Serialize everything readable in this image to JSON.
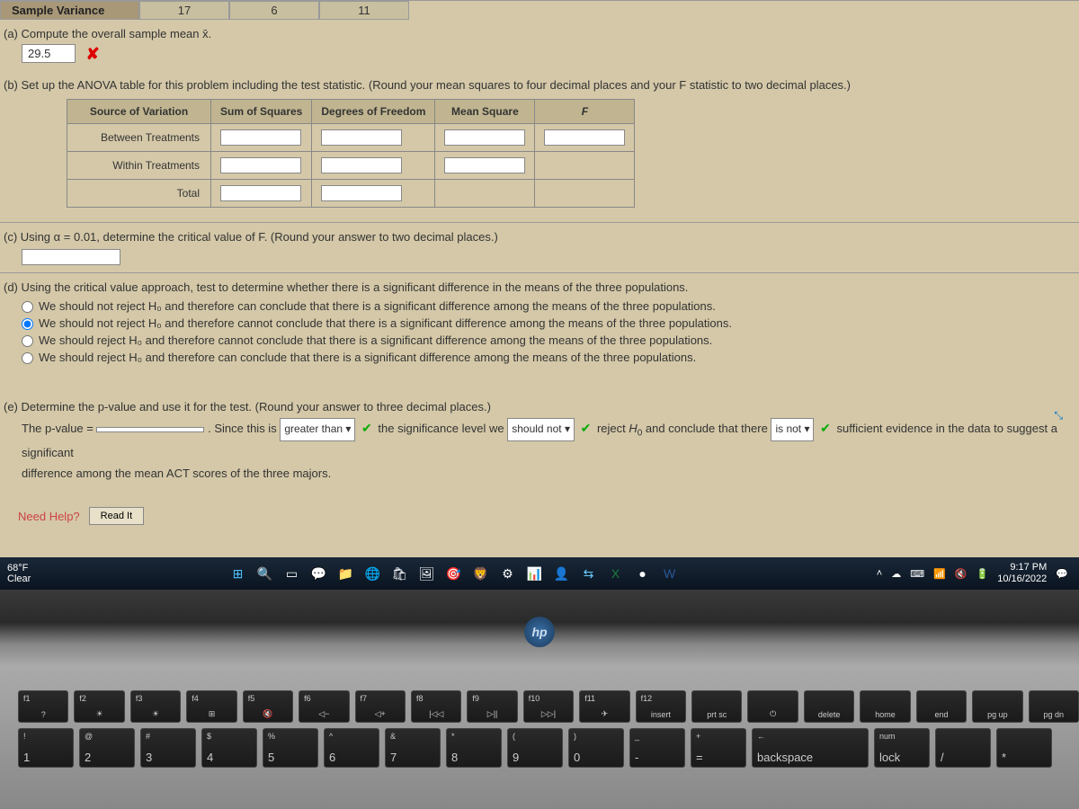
{
  "top_row": {
    "label": "Sample Variance",
    "cells": [
      "17",
      "6",
      "11"
    ]
  },
  "part_a": {
    "label": "(a)",
    "prompt": "Compute the overall sample mean x̄.",
    "value": "29.5"
  },
  "part_b": {
    "label": "(b)",
    "prompt": "Set up the ANOVA table for this problem including the test statistic. (Round your mean squares to four decimal places and your F statistic to two decimal places.)"
  },
  "anova": {
    "headers": [
      "Source of Variation",
      "Sum of Squares",
      "Degrees of Freedom",
      "Mean Square",
      "F"
    ],
    "rows": [
      "Between Treatments",
      "Within Treatments",
      "Total"
    ]
  },
  "part_c": {
    "label": "(c)",
    "prompt": "Using α = 0.01, determine the critical value of F. (Round your answer to two decimal places.)"
  },
  "part_d": {
    "label": "(d)",
    "prompt": "Using the critical value approach, test to determine whether there is a significant difference in the means of the three populations.",
    "options": [
      "We should not reject H₀ and therefore can conclude that there is a significant difference among the means of the three populations.",
      "We should not reject H₀ and therefore cannot conclude that there is a significant difference among the means of the three populations.",
      "We should reject H₀ and therefore cannot conclude that there is a significant difference among the means of the three populations.",
      "We should reject H₀ and therefore can conclude that there is a significant difference among the means of the three populations."
    ],
    "selected": 1
  },
  "part_e": {
    "label": "(e)",
    "prompt": "Determine the p-value and use it for the test. (Round your answer to three decimal places.)",
    "line_prefix": "The p-value =",
    "since": ". Since this is",
    "sel1": "greater than",
    "middle": "the significance level we",
    "sel2": "should not",
    "reject": "reject H₀ and conclude that there",
    "sel3": "is not",
    "suffix": "sufficient evidence in the data to suggest a significant",
    "line2": "difference among the mean ACT scores of the three majors."
  },
  "help": {
    "label": "Need Help?",
    "button": "Read It"
  },
  "taskbar": {
    "weather_temp": "68°F",
    "weather_desc": "Clear",
    "time": "9:17 PM",
    "date": "10/16/2022"
  },
  "hp": "hp",
  "keys_fn": [
    {
      "t": "f1",
      "m": "?"
    },
    {
      "t": "f2",
      "m": "☀"
    },
    {
      "t": "f3",
      "m": "☀"
    },
    {
      "t": "f4",
      "m": "⊞"
    },
    {
      "t": "f5",
      "m": "🔇"
    },
    {
      "t": "f6",
      "m": "◁−"
    },
    {
      "t": "f7",
      "m": "◁+"
    },
    {
      "t": "f8",
      "m": "|◁◁"
    },
    {
      "t": "f9",
      "m": "▷||"
    },
    {
      "t": "f10",
      "m": "▷▷|"
    },
    {
      "t": "f11",
      "m": "✈"
    },
    {
      "t": "f12",
      "m": "insert"
    },
    {
      "t": "",
      "m": "prt sc"
    },
    {
      "t": "",
      "m": "⏻"
    },
    {
      "t": "",
      "m": "delete"
    },
    {
      "t": "",
      "m": "home"
    },
    {
      "t": "",
      "m": "end"
    },
    {
      "t": "",
      "m": "pg up"
    },
    {
      "t": "",
      "m": "pg dn"
    }
  ],
  "keys_num": [
    {
      "t": "!",
      "b": "1"
    },
    {
      "t": "@",
      "b": "2"
    },
    {
      "t": "#",
      "b": "3"
    },
    {
      "t": "$",
      "b": "4"
    },
    {
      "t": "%",
      "b": "5"
    },
    {
      "t": "^",
      "b": "6"
    },
    {
      "t": "&",
      "b": "7"
    },
    {
      "t": "*",
      "b": "8"
    },
    {
      "t": "(",
      "b": "9"
    },
    {
      "t": ")",
      "b": "0"
    },
    {
      "t": "_",
      "b": "-"
    },
    {
      "t": "+",
      "b": "="
    },
    {
      "t": "←",
      "b": "backspace"
    },
    {
      "t": "num",
      "b": "lock"
    },
    {
      "t": "",
      "b": "/"
    },
    {
      "t": "",
      "b": "*"
    }
  ]
}
